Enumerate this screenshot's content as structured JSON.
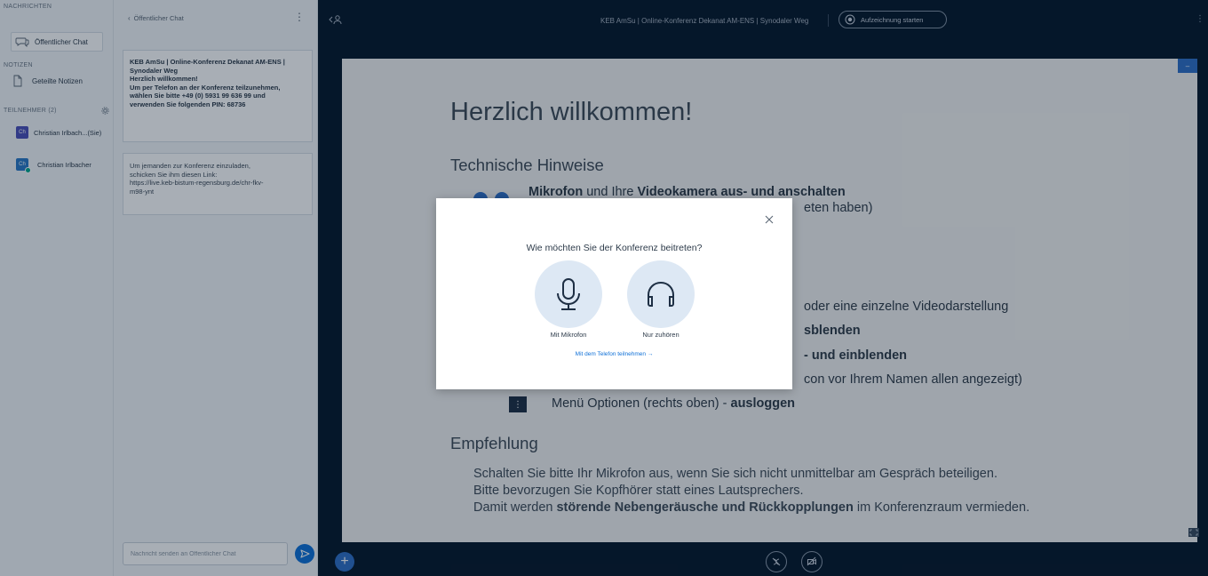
{
  "left_nav": {
    "messages_heading": "NACHRICHTEN",
    "public_chat": "Öffentlicher Chat",
    "notes_heading": "NOTIZEN",
    "shared_notes": "Geteilte Notizen",
    "participants_heading": "TEILNEHMER (2)",
    "users": [
      {
        "initials": "Ch",
        "name": "Christian Irlbach...(Sie)"
      },
      {
        "initials": "Ch",
        "name": "Christian Irlbacher"
      }
    ]
  },
  "chat": {
    "title": "Öffentlicher Chat",
    "welcome": {
      "line1": "KEB AmSu | Online-Konferenz Dekanat AM-ENS |",
      "line2": "Synodaler Weg",
      "line3": "Herzlich willkommen!",
      "line4": "Um per Telefon an der Konferenz teilzunehmen,",
      "line5": "wählen Sie bitte +49 (0) 5931 99 636 99 und",
      "line6": "verwenden Sie folgenden PIN: 68736"
    },
    "invite": {
      "line1": "Um jemanden zur Konferenz einzuladen,",
      "line2": "schicken Sie ihm diesen Link:",
      "line3": "https://live.keb-bistum-regensburg.de/chr-fkv-",
      "line4": "m98-ynt"
    },
    "input_placeholder": "Nachricht senden an Öffentlicher Chat"
  },
  "top_bar": {
    "meeting_title": "KEB AmSu | Online-Konferenz Dekanat AM-ENS | Synodaler Weg",
    "record_label": "Aufzeichnung starten"
  },
  "slide": {
    "title": "Herzlich willkommen!",
    "tech_heading": "Technische Hinweise",
    "item1_a": "Mikrofon",
    "item1_b": " und Ihre ",
    "item1_c": "Videokamera aus- und anschalten",
    "item1_tail": "eten haben)",
    "item2_tail": "oder eine einzelne Videodarstellung",
    "item3_tail": "sblenden",
    "item4_tail": "- und einblenden",
    "item5_tail": "con vor Ihrem Namen allen angezeigt)",
    "menu_text": "Menü Optionen (rechts oben) - ",
    "menu_bold": "ausloggen",
    "recommend_heading": "Empfehlung",
    "rec1": "Schalten Sie bitte Ihr Mikrofon aus, wenn Sie sich nicht unmittelbar am Gespräch beteiligen.",
    "rec2": "Bitte bevorzugen Sie Kopfhörer statt eines Lautsprechers.",
    "rec3_a": "Damit werden ",
    "rec3_b": "störende Nebengeräusche und Rückkopplungen",
    "rec3_c": " im Konferenzraum vermieden."
  },
  "modal": {
    "title": "Wie möchten Sie der Konferenz beitreten?",
    "mic_label": "Mit Mikrofon",
    "listen_label": "Nur zuhören",
    "phone_link": "Mit dem Telefon teilnehmen →"
  },
  "colors": {
    "accent": "#0f70d7",
    "dark_bg": "#06172a",
    "panel_bg": "#f3f6f9"
  }
}
